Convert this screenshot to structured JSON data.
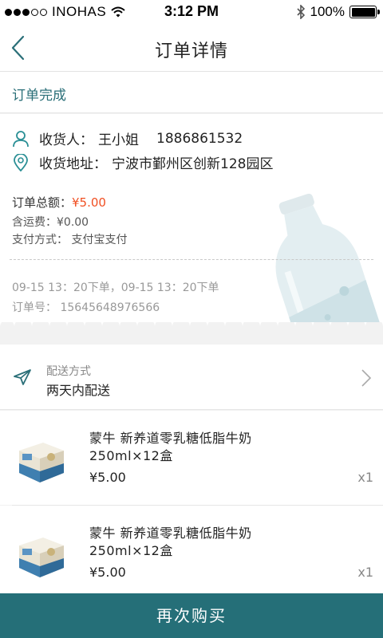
{
  "status_bar": {
    "carrier": "INOHAS",
    "time": "3:12 PM",
    "battery": "100%"
  },
  "header": {
    "title": "订单详情"
  },
  "order": {
    "status": "订单完成",
    "recipient_label": "收货人：",
    "recipient_name": "王小姐",
    "recipient_phone": "1886861532",
    "address_label": "收货地址：",
    "address": "宁波市鄞州区创新128园区",
    "total_label": "订单总额：",
    "total_value": "¥5.00",
    "shipping_line": "含运费：¥0.00",
    "payment_line": "支付方式：  支付宝支付",
    "time_line": "09-15 13：20下单，09-15 13：20下单",
    "order_no_line": "订单号：  15645648976566"
  },
  "delivery": {
    "label": "配送方式",
    "value": "两天内配送"
  },
  "products": [
    {
      "name": "蒙牛  新养道零乳糖低脂牛奶250ml×12盒",
      "price": "¥5.00",
      "qty": "x1"
    },
    {
      "name": "蒙牛  新养道零乳糖低脂牛奶250ml×12盒",
      "price": "¥5.00",
      "qty": "x1"
    }
  ],
  "actions": {
    "buy_again": "再次购买"
  },
  "colors": {
    "accent": "#256f78",
    "price_red": "#f04f22"
  }
}
